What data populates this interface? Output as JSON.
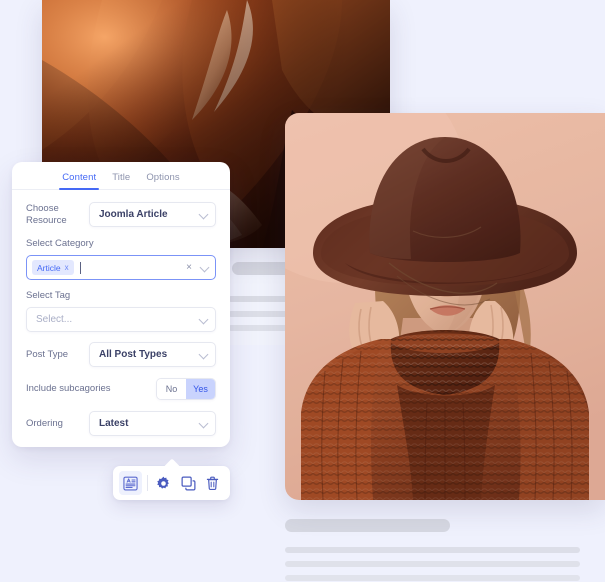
{
  "page": {
    "background_color": "#eff1fd",
    "accent_color": "#4569f5"
  },
  "photos": [
    {
      "name": "canyon-abstract-photo",
      "alt": "Abstract orange canyon rock formation"
    },
    {
      "name": "portrait-photo",
      "alt": "Woman wearing brown fedora hat and rust knit turtleneck sweater"
    }
  ],
  "panel": {
    "tabs": [
      {
        "label": "Content",
        "active": true
      },
      {
        "label": "Title",
        "active": false
      },
      {
        "label": "Options",
        "active": false
      }
    ],
    "fields": {
      "choose_resource": {
        "label": "Choose Resource",
        "value": "Joomla Article",
        "icon": "chevron-down-icon"
      },
      "select_category": {
        "label": "Select Category",
        "chips": [
          "Article"
        ],
        "chip_remove_icon": "x",
        "clear_icon": "×",
        "icon": "chevron-down-icon"
      },
      "select_tag": {
        "label": "Select Tag",
        "placeholder": "Select...",
        "value": "Select...",
        "icon": "chevron-down-icon"
      },
      "post_type": {
        "label": "Post Type",
        "value": "All Post Types",
        "icon": "chevron-down-icon"
      },
      "include_subcategories": {
        "label": "Include subcagories",
        "options": [
          {
            "label": "No",
            "selected": false
          },
          {
            "label": "Yes",
            "selected": true
          }
        ]
      },
      "ordering": {
        "label": "Ordering",
        "value": "Latest",
        "icon": "chevron-down-icon"
      }
    }
  },
  "toolbar": {
    "buttons": [
      {
        "name": "edit-content-icon",
        "title": "Edit content",
        "active": true
      },
      {
        "name": "gear-icon",
        "title": "Settings",
        "active": false
      },
      {
        "name": "duplicate-icon",
        "title": "Duplicate",
        "active": false
      },
      {
        "name": "trash-icon",
        "title": "Delete",
        "active": false
      }
    ]
  }
}
